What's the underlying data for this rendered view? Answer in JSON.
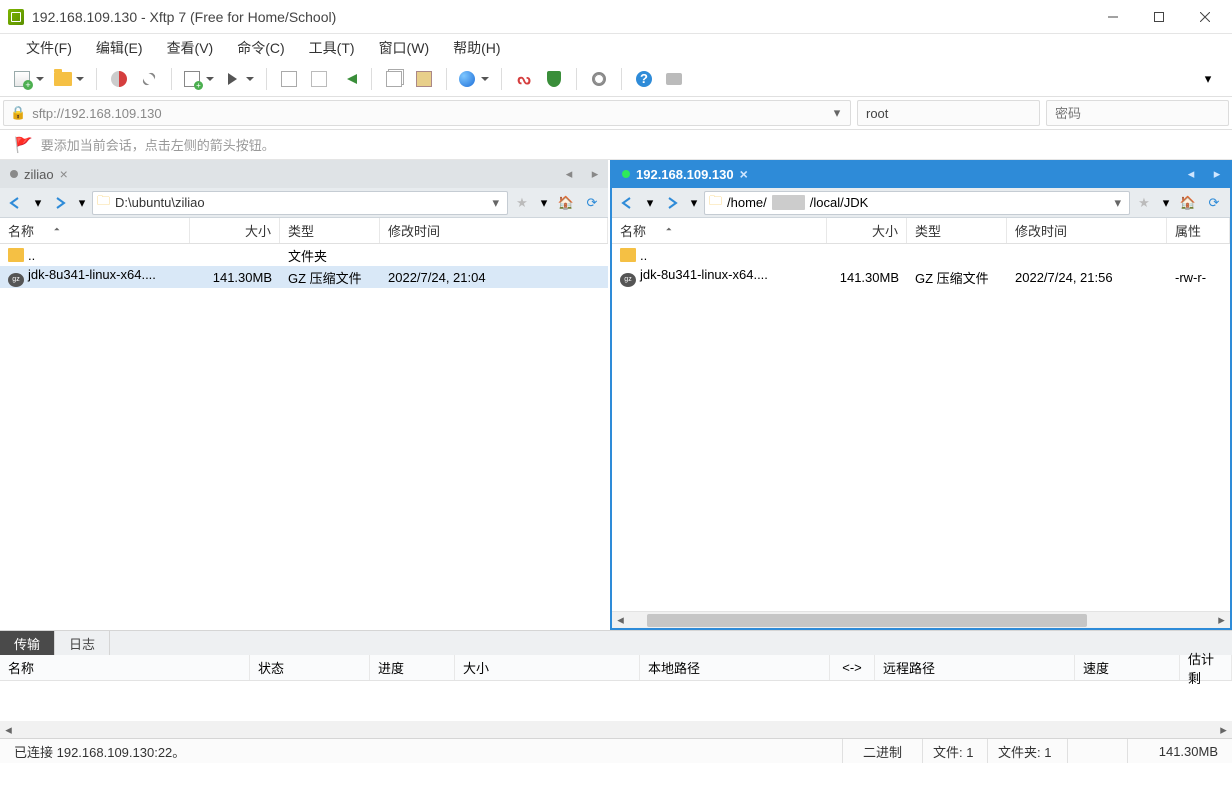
{
  "window": {
    "title": "192.168.109.130 - Xftp 7 (Free for Home/School)"
  },
  "menu": [
    "文件(F)",
    "编辑(E)",
    "查看(V)",
    "命令(C)",
    "工具(T)",
    "窗口(W)",
    "帮助(H)"
  ],
  "address": {
    "url": "sftp://192.168.109.130",
    "username": "root",
    "password_placeholder": "密码"
  },
  "hint": "要添加当前会话，点击左侧的箭头按钮。",
  "panes": {
    "left": {
      "tab_label": "ziliao",
      "active": false,
      "path": "D:\\ubuntu\\ziliao",
      "columns": {
        "name": "名称",
        "size": "大小",
        "type": "类型",
        "mtime": "修改时间"
      },
      "rows": [
        {
          "icon": "folder",
          "name": "..",
          "size": "",
          "type": "文件夹",
          "mtime": "",
          "selected": false
        },
        {
          "icon": "gz",
          "name": "jdk-8u341-linux-x64....",
          "size": "141.30MB",
          "type": "GZ 压缩文件",
          "mtime": "2022/7/24, 21:04",
          "selected": true
        }
      ]
    },
    "right": {
      "tab_label": "192.168.109.130",
      "active": true,
      "path_prefix": "/home/",
      "path_suffix": "/local/JDK",
      "columns": {
        "name": "名称",
        "size": "大小",
        "type": "类型",
        "mtime": "修改时间",
        "perm": "属性"
      },
      "rows": [
        {
          "icon": "folder",
          "name": "..",
          "size": "",
          "type": "",
          "mtime": "",
          "perm": "",
          "selected": false
        },
        {
          "icon": "gz",
          "name": "jdk-8u341-linux-x64....",
          "size": "141.30MB",
          "type": "GZ 压缩文件",
          "mtime": "2022/7/24, 21:56",
          "perm": "-rw-r-",
          "selected": false
        }
      ]
    }
  },
  "output": {
    "tabs": [
      "传输",
      "日志"
    ],
    "active_tab": 0,
    "columns": [
      "名称",
      "状态",
      "进度",
      "大小",
      "本地路径",
      "<->",
      "远程路径",
      "速度",
      "估计剩"
    ]
  },
  "status": {
    "connection": "已连接 192.168.109.130:22。",
    "mode": "二进制",
    "files": "文件: 1",
    "folders": "文件夹: 1",
    "total_size": "141.30MB"
  }
}
